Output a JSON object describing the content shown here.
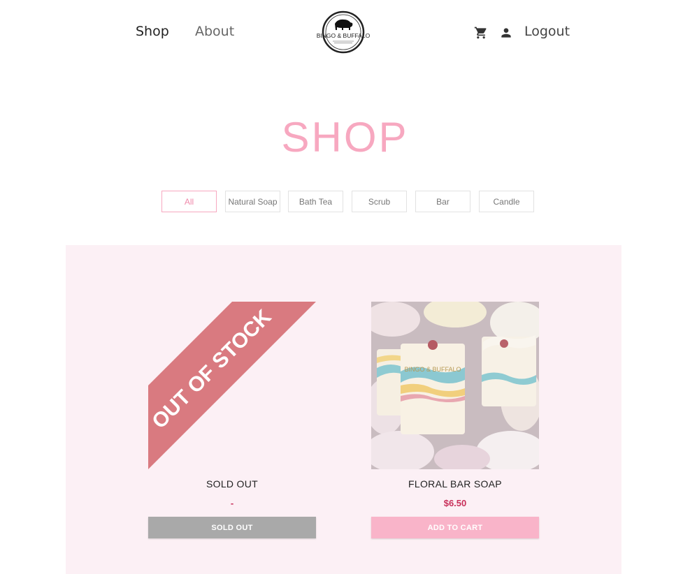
{
  "nav": {
    "shop": "Shop",
    "about": "About",
    "logout": "Logout",
    "logo_text": "BINGO & BUFFALO",
    "cart_icon": "shopping-cart-icon",
    "user_icon": "account-icon"
  },
  "page": {
    "title": "SHOP"
  },
  "filters": [
    {
      "label": "All",
      "active": true
    },
    {
      "label": "Natural Soap",
      "active": false
    },
    {
      "label": "Bath Tea",
      "active": false
    },
    {
      "label": "Scrub",
      "active": false
    },
    {
      "label": "Bar",
      "active": false
    },
    {
      "label": "Candle",
      "active": false
    }
  ],
  "products": [
    {
      "ribbon": "OUT OF STOCK",
      "name": "SOLD OUT",
      "price": "-",
      "button": "SOLD OUT"
    },
    {
      "name": "FLORAL BAR SOAP",
      "price": "$6.50",
      "button": "ADD TO CART",
      "soap_stamp": "BINGO & BUFFALO"
    }
  ],
  "colors": {
    "accent_pink": "#f7a8c0",
    "price_red": "#c8305a",
    "panel_bg": "#fcf0f5",
    "ribbon": "#d97a80"
  }
}
